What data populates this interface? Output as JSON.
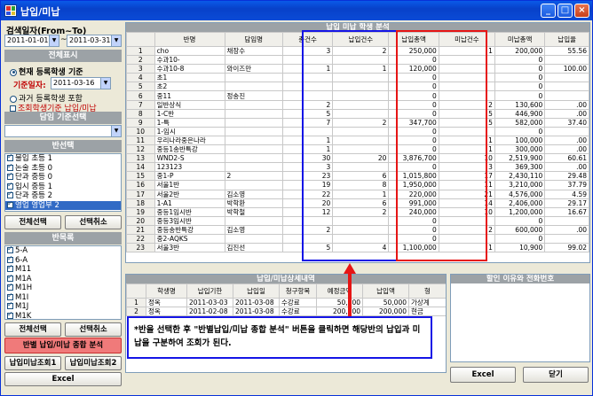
{
  "window": {
    "title": "납입/미납",
    "min": "_",
    "max": "□",
    "close": "×"
  },
  "search": {
    "label": "검색일자(From~To)",
    "from": "2011-01-01",
    "sep": "~",
    "to": "2011-03-31"
  },
  "total_display": {
    "title": "전체표시",
    "radio_current": "현재 등록학생 기준",
    "base_date_label": "기준일자:",
    "base_date": "2011-03-16",
    "radio_past": "과거 등록학생 포함",
    "check_inquiry": "조회학생기준 납입/미납"
  },
  "teacher": {
    "title": "담임 기준선택"
  },
  "class_select": {
    "title": "반선택",
    "items": [
      {
        "label": "불입 초등 1",
        "checked": true,
        "selected": false
      },
      {
        "label": "논술 초등 0",
        "checked": true,
        "selected": false
      },
      {
        "label": "단과 중등 0",
        "checked": true,
        "selected": false
      },
      {
        "label": "입시 중등 1",
        "checked": true,
        "selected": false
      },
      {
        "label": "단과 중등 2",
        "checked": true,
        "selected": false
      },
      {
        "label": "영업 영업부 2",
        "checked": true,
        "selected": true
      }
    ],
    "all_btn": "전체선택",
    "cancel_btn": "선택취소"
  },
  "class_list": {
    "title": "반목록",
    "items": [
      {
        "label": "5-A",
        "checked": true,
        "selected": false
      },
      {
        "label": "6-A",
        "checked": true,
        "selected": false
      },
      {
        "label": "M11",
        "checked": true,
        "selected": false
      },
      {
        "label": "M1A",
        "checked": true,
        "selected": false
      },
      {
        "label": "M1H",
        "checked": true,
        "selected": false
      },
      {
        "label": "M1I",
        "checked": true,
        "selected": false
      },
      {
        "label": "M1J",
        "checked": true,
        "selected": false
      },
      {
        "label": "M1K",
        "checked": true,
        "selected": false
      },
      {
        "label": "영업4반",
        "checked": true,
        "selected": false
      },
      {
        "label": "영업5반",
        "checked": true,
        "selected": false
      },
      {
        "label": "영업6부",
        "checked": true,
        "selected": true
      }
    ],
    "all_btn": "전체선택",
    "cancel_btn": "선택취소"
  },
  "buttons": {
    "analysis": "반별 납입/미납 종합 분석",
    "unpaid1": "납입미납조회1",
    "unpaid2": "납입미납조회2",
    "excel_left": "Excel",
    "excel_right": "Excel",
    "close": "닫기"
  },
  "main_grid": {
    "title": "납입 미납 학생 분석",
    "columns": [
      "",
      "반명",
      "담임명",
      "총건수",
      "납입건수",
      "납입총액",
      "미납건수",
      "미납총액",
      "납입율"
    ],
    "rows": [
      [
        "1",
        "cho",
        "채장수",
        "3",
        "2",
        "250,000",
        "1",
        "200,000",
        "55.56"
      ],
      [
        "2",
        "수과10-",
        "",
        "",
        "",
        "0",
        "",
        "0",
        ""
      ],
      [
        "3",
        "수과10-8",
        "와이즈만",
        "1",
        "1",
        "120,000",
        "",
        "0",
        "100.00"
      ],
      [
        "4",
        "초1",
        "",
        "",
        "",
        "0",
        "",
        "0",
        ""
      ],
      [
        "5",
        "초2",
        "",
        "",
        "",
        "0",
        "",
        "0",
        ""
      ],
      [
        "6",
        "중11",
        "정송진",
        "",
        "",
        "0",
        "",
        "0",
        ""
      ],
      [
        "7",
        "일반상식",
        "",
        "2",
        "",
        "0",
        "2",
        "130,600",
        ".00"
      ],
      [
        "8",
        "1-C반",
        "",
        "5",
        "",
        "0",
        "5",
        "446,900",
        ".00"
      ],
      [
        "9",
        "1-특",
        "",
        "7",
        "2",
        "347,700",
        "5",
        "582,000",
        "37.40"
      ],
      [
        "10",
        "1-임시",
        "",
        "",
        "",
        "0",
        "",
        "0",
        ""
      ],
      [
        "11",
        "우리나라중은나라",
        "",
        "1",
        "",
        "0",
        "1",
        "100,000",
        ".00"
      ],
      [
        "12",
        "중등1송반특강",
        "",
        "1",
        "",
        "0",
        "1",
        "300,000",
        ".00"
      ],
      [
        "13",
        "WND2-S",
        "",
        "30",
        "20",
        "3,876,700",
        "10",
        "2,519,900",
        "60.61"
      ],
      [
        "14",
        "123123",
        "",
        "3",
        "",
        "0",
        "3",
        "369,300",
        ".00"
      ],
      [
        "15",
        "중1-P",
        "2",
        "23",
        "6",
        "1,015,800",
        "17",
        "2,430,110",
        "29.48"
      ],
      [
        "16",
        "서울1반",
        "",
        "19",
        "8",
        "1,950,000",
        "11",
        "3,210,000",
        "37.79"
      ],
      [
        "17",
        "서울2반",
        "김소영",
        "22",
        "1",
        "220,000",
        "21",
        "4,576,000",
        "4.59"
      ],
      [
        "18",
        "1-A1",
        "박학환",
        "20",
        "6",
        "991,000",
        "14",
        "2,406,000",
        "29.17"
      ],
      [
        "19",
        "중등1임시반",
        "박학철",
        "12",
        "2",
        "240,000",
        "10",
        "1,200,000",
        "16.67"
      ],
      [
        "20",
        "중등3임시반",
        "",
        "",
        "",
        "0",
        "",
        "0",
        ""
      ],
      [
        "21",
        "중등송반특강",
        "김소영",
        "2",
        "",
        "0",
        "2",
        "600,000",
        ".00"
      ],
      [
        "22",
        "중2-AQKS",
        "",
        "",
        "",
        "0",
        "",
        "0",
        ""
      ],
      [
        "23",
        "서울3반",
        "김진선",
        "5",
        "4",
        "1,100,000",
        "1",
        "10,900",
        "99.02"
      ]
    ]
  },
  "detail_grid": {
    "title": "납입/미납상세내역",
    "columns": [
      "",
      "학생명",
      "납입기한",
      "납입일",
      "청구항목",
      "예정금액",
      "납입액",
      "형"
    ],
    "rows": [
      [
        "1",
        "정옥",
        "2011-03-03",
        "2011-03-08",
        "수강료",
        "50,000",
        "50,000",
        "가상계"
      ],
      [
        "2",
        "정옥",
        "2011-02-08",
        "2011-03-08",
        "수강료",
        "200,000",
        "200,000",
        "현금"
      ]
    ]
  },
  "discount": {
    "title": "할인 이유와 전화번호"
  },
  "callout": {
    "text": "*반을 선택한 후 \"반별납입/미납 종합 분석\" 버튼을 클릭하면 해당반의 납입과 미납을 구분하여 조회가 된다."
  }
}
